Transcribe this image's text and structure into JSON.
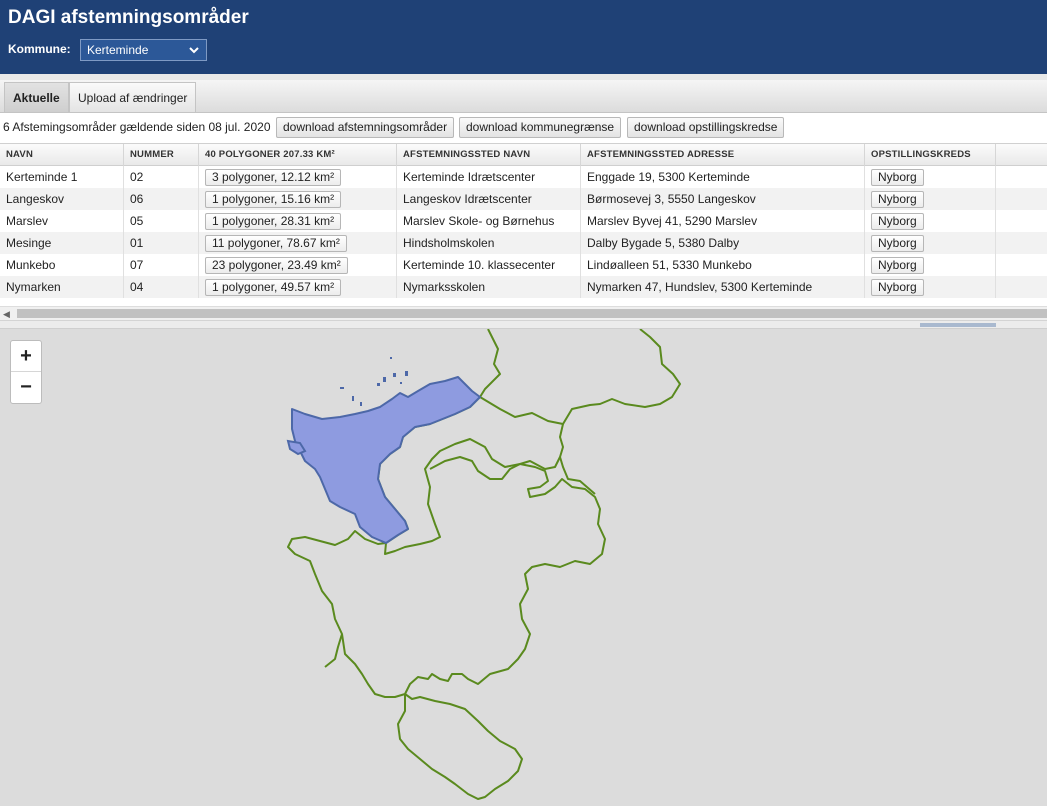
{
  "header": {
    "title": "DAGI afstemningsområder",
    "kommune_label": "Kommune:",
    "kommune_value": "Kerteminde"
  },
  "tabs": [
    {
      "label": "Aktuelle",
      "active": true
    },
    {
      "label": "Upload af ændringer",
      "active": false
    }
  ],
  "summary": {
    "text": "6 Afstemingsområder gældende siden 08 jul. 2020",
    "buttons": [
      "download afstemningsområder",
      "download kommunegrænse",
      "download opstillingskredse"
    ]
  },
  "table": {
    "columns": [
      "NAVN",
      "NUMMER",
      "40 POLYGONER 207.33 KM²",
      "AFSTEMNINGSSTED NAVN",
      "AFSTEMNINGSSTED ADRESSE",
      "OPSTILLINGSKREDS"
    ],
    "rows": [
      {
        "navn": "Kerteminde 1",
        "nummer": "02",
        "polygoner": "3 polygoner, 12.12 km²",
        "sted_navn": "Kerteminde Idrætscenter",
        "sted_adresse": "Enggade 19, 5300 Kerteminde",
        "kreds": "Nyborg"
      },
      {
        "navn": "Langeskov",
        "nummer": "06",
        "polygoner": "1 polygoner, 15.16 km²",
        "sted_navn": "Langeskov Idrætscenter",
        "sted_adresse": "Børmosevej 3, 5550 Langeskov",
        "kreds": "Nyborg"
      },
      {
        "navn": "Marslev",
        "nummer": "05",
        "polygoner": "1 polygoner, 28.31 km²",
        "sted_navn": "Marslev Skole- og Børnehus",
        "sted_adresse": "Marslev Byvej 41, 5290 Marslev",
        "kreds": "Nyborg"
      },
      {
        "navn": "Mesinge",
        "nummer": "01",
        "polygoner": "11 polygoner, 78.67 km²",
        "sted_navn": "Hindsholmskolen",
        "sted_adresse": "Dalby Bygade 5, 5380 Dalby",
        "kreds": "Nyborg"
      },
      {
        "navn": "Munkebo",
        "nummer": "07",
        "polygoner": "23 polygoner, 23.49 km²",
        "sted_navn": "Kerteminde 10. klassecenter",
        "sted_adresse": "Lindøalleen 51, 5330 Munkebo",
        "kreds": "Nyborg"
      },
      {
        "navn": "Nymarken",
        "nummer": "04",
        "polygoner": "1 polygoner, 49.57 km²",
        "sted_navn": "Nymarksskolen",
        "sted_adresse": "Nymarken 47, Hundslev, 5300 Kerteminde",
        "kreds": "Nyborg"
      }
    ]
  },
  "map": {
    "zoom_in": "+",
    "zoom_out": "−",
    "colors": {
      "background": "#dcdcdc",
      "boundary": "#5a8a1e",
      "selected_fill": "#8e9be0",
      "selected_stroke": "#4d68a8"
    }
  }
}
